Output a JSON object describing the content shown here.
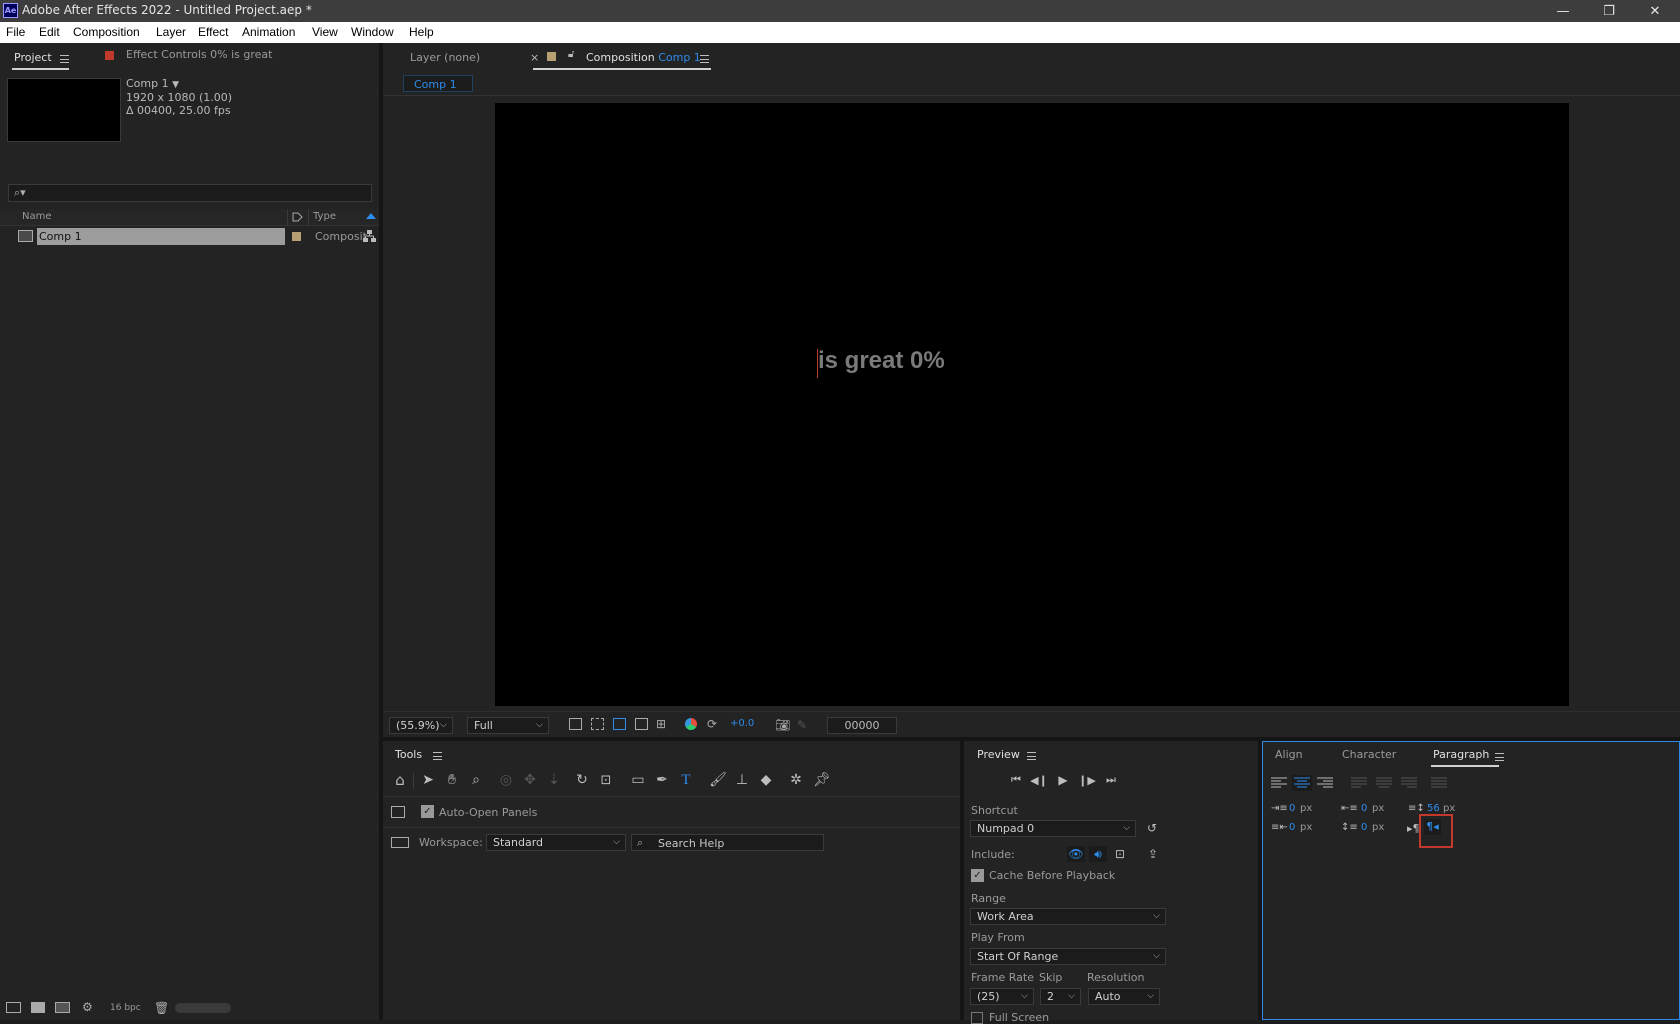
{
  "window": {
    "title": "Adobe After Effects 2022 - Untitled Project.aep *",
    "logo_text": "Ae",
    "minimize": "—",
    "restore": "❐",
    "close": "✕"
  },
  "menu": [
    "File",
    "Edit",
    "Composition",
    "Layer",
    "Effect",
    "Animation",
    "View",
    "Window",
    "Help"
  ],
  "project_panel": {
    "tab_project": "Project",
    "tab_effect_controls": "Effect Controls 0% is great",
    "comp_name": "Comp 1",
    "comp_resolution": "1920 x 1080 (1.00)",
    "comp_duration": "Δ 00400, 25.00 fps",
    "search_placeholder": "",
    "col_name": "Name",
    "col_type": "Type",
    "items": [
      {
        "name": "Comp 1",
        "type": "Composit"
      }
    ],
    "bpc_label": "16 bpc"
  },
  "viewer": {
    "tab_layer": "Layer (none)",
    "tab_composition_prefix": "Composition",
    "tab_composition_name": "Comp 1",
    "breadcrumb": "Comp 1",
    "canvas_text": "is great 0%",
    "zoom": "(55.9%)",
    "resolution": "Full",
    "exposure": "+0.0",
    "timecode": "00000",
    "accent_color": "#2d8ceb"
  },
  "tools_panel": {
    "title": "Tools",
    "auto_open_label": "Auto-Open Panels",
    "auto_open_checked": true,
    "workspace_label": "Workspace:",
    "workspace_value": "Standard",
    "search_help_placeholder": "Search Help"
  },
  "preview_panel": {
    "title": "Preview",
    "shortcut_label": "Shortcut",
    "shortcut_value": "Numpad 0",
    "include_label": "Include:",
    "cache_label": "Cache Before Playback",
    "cache_checked": true,
    "range_label": "Range",
    "range_value": "Work Area",
    "play_from_label": "Play From",
    "play_from_value": "Start Of Range",
    "frame_rate_label": "Frame Rate",
    "frame_rate_value": "(25)",
    "skip_label": "Skip",
    "skip_value": "2",
    "resolution_label": "Resolution",
    "resolution_value": "Auto",
    "full_screen_label": "Full Screen"
  },
  "paragraph_panel": {
    "tab_align": "Align",
    "tab_character": "Character",
    "tab_paragraph": "Paragraph",
    "indent_left": "0",
    "indent_first": "0",
    "indent_right": "0",
    "space_before": "0",
    "space_after": "56",
    "unit": "px",
    "highlight_color": "#c0392b"
  }
}
